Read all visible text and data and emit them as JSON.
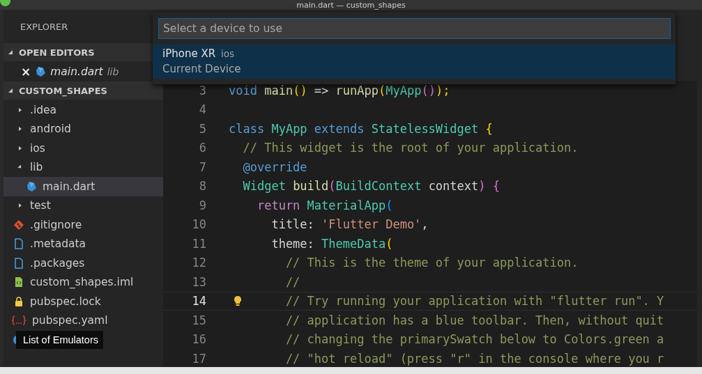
{
  "window": {
    "title": "main.dart — custom_shapes"
  },
  "sidebar": {
    "title": "EXPLORER",
    "sections": [
      {
        "title": "OPEN EDITORS",
        "expanded": true,
        "items": [
          {
            "name": "main.dart",
            "kind": "dart",
            "detail": "lib",
            "close": "×"
          }
        ]
      },
      {
        "title": "CUSTOM_SHAPES",
        "expanded": true,
        "items": [
          {
            "name": ".idea",
            "kind": "folder",
            "expanded": false,
            "selected": false
          },
          {
            "name": "android",
            "kind": "folder",
            "expanded": false,
            "selected": false
          },
          {
            "name": "ios",
            "kind": "folder",
            "expanded": false,
            "selected": false
          },
          {
            "name": "lib",
            "kind": "folder",
            "expanded": true,
            "selected": false,
            "children": [
              {
                "name": "main.dart",
                "kind": "dart",
                "selected": true
              }
            ]
          },
          {
            "name": "test",
            "kind": "folder",
            "expanded": false,
            "selected": false
          },
          {
            "name": ".gitignore",
            "kind": "git",
            "selected": false
          },
          {
            "name": ".metadata",
            "kind": "file",
            "selected": false
          },
          {
            "name": ".packages",
            "kind": "file",
            "selected": false
          },
          {
            "name": "custom_shapes.iml",
            "kind": "xml",
            "selected": false
          },
          {
            "name": "pubspec.lock",
            "kind": "lock",
            "selected": false
          },
          {
            "name": "pubspec.yaml",
            "kind": "json",
            "selected": false
          }
        ]
      }
    ]
  },
  "tooltip": {
    "text": "List of Emulators"
  },
  "quick_pick": {
    "placeholder": "Select a device to use",
    "items": [
      {
        "label": "iPhone XR",
        "detail": "ios",
        "description": "Current Device",
        "selected": true
      }
    ]
  },
  "editor": {
    "lines": [
      {
        "number": "3",
        "current": false,
        "tokens": [
          {
            "text": "void ",
            "kind": "keyword"
          },
          {
            "text": "main",
            "kind": "function"
          },
          {
            "text": "() ",
            "kind": "bracket"
          },
          {
            "text": "=> ",
            "kind": "plain"
          },
          {
            "text": "runApp",
            "kind": "function"
          },
          {
            "text": "(",
            "kind": "bracket"
          },
          {
            "text": "MyApp",
            "kind": "type"
          },
          {
            "text": "()",
            "kind": "bracket2"
          },
          {
            "text": ");",
            "kind": "bracket"
          }
        ]
      },
      {
        "number": "4",
        "current": false
      },
      {
        "number": "5",
        "current": false,
        "tokens": [
          {
            "text": "class ",
            "kind": "keyword"
          },
          {
            "text": "MyApp ",
            "kind": "type"
          },
          {
            "text": "extends ",
            "kind": "keyword"
          },
          {
            "text": "StatelessWidget",
            "kind": "type"
          },
          {
            "text": " {",
            "kind": "bracket"
          }
        ]
      },
      {
        "number": "6",
        "current": false,
        "tokens": [
          {
            "text": "  // This widget is the root of your application.",
            "kind": "comment"
          }
        ]
      },
      {
        "number": "7",
        "current": false,
        "tokens": [
          {
            "text": "  @override",
            "kind": "keyword"
          }
        ]
      },
      {
        "number": "8",
        "current": false,
        "tokens": [
          {
            "text": "  Widget ",
            "kind": "type"
          },
          {
            "text": "build",
            "kind": "function"
          },
          {
            "text": "(",
            "kind": "bracket2"
          },
          {
            "text": "BuildContext ",
            "kind": "type"
          },
          {
            "text": "context",
            "kind": "plain"
          },
          {
            "text": ") {",
            "kind": "bracket2"
          }
        ]
      },
      {
        "number": "9",
        "current": false,
        "tokens": [
          {
            "text": "    return ",
            "kind": "control"
          },
          {
            "text": "MaterialApp",
            "kind": "type"
          },
          {
            "text": "(",
            "kind": "bracket3"
          }
        ]
      },
      {
        "number": "10",
        "current": false,
        "tokens": [
          {
            "text": "      title: ",
            "kind": "plain"
          },
          {
            "text": "'Flutter Demo'",
            "kind": "string"
          },
          {
            "text": ",",
            "kind": "plain"
          }
        ]
      },
      {
        "number": "11",
        "current": false,
        "tokens": [
          {
            "text": "      theme: ",
            "kind": "plain"
          },
          {
            "text": "ThemeData",
            "kind": "type"
          },
          {
            "text": "(",
            "kind": "bracket"
          }
        ]
      },
      {
        "number": "12",
        "current": false,
        "tokens": [
          {
            "text": "        // This is the theme of your application.",
            "kind": "comment"
          }
        ]
      },
      {
        "number": "13",
        "current": false,
        "tokens": [
          {
            "text": "        //",
            "kind": "comment"
          }
        ]
      },
      {
        "number": "14",
        "current": true,
        "tokens": [
          {
            "text": "        // Try running your application with \"flutter run\". Y",
            "kind": "comment"
          }
        ]
      },
      {
        "number": "15",
        "current": false,
        "tokens": [
          {
            "text": "        // application has a blue toolbar. Then, without quit",
            "kind": "comment"
          }
        ]
      },
      {
        "number": "16",
        "current": false,
        "tokens": [
          {
            "text": "        // changing the primarySwatch below to Colors.green a",
            "kind": "comment"
          }
        ]
      },
      {
        "number": "17",
        "current": false,
        "tokens": [
          {
            "text": "        // \"hot reload\" (press \"r\" in the console where you r",
            "kind": "comment"
          }
        ]
      }
    ]
  }
}
